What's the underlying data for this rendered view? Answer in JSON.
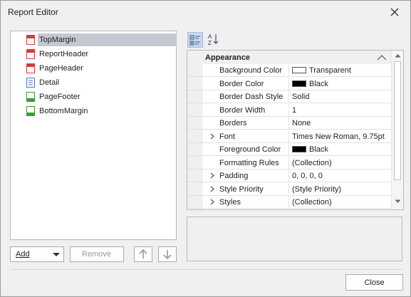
{
  "window": {
    "title": "Report Editor"
  },
  "tree": {
    "items": [
      {
        "label": "TopMargin",
        "icon": "band-icon",
        "color": "#d83b3b",
        "selected": true
      },
      {
        "label": "ReportHeader",
        "icon": "band-icon",
        "color": "#d83b3b"
      },
      {
        "label": "PageHeader",
        "icon": "band-icon",
        "color": "#d83b3b"
      },
      {
        "label": "Detail",
        "icon": "detail-band-icon",
        "color": "#4a78c2"
      },
      {
        "label": "PageFooter",
        "icon": "band-icon",
        "color": "#3c9a3c"
      },
      {
        "label": "BottomMargin",
        "icon": "band-icon",
        "color": "#3c9a3c"
      }
    ]
  },
  "buttons": {
    "add": "Add",
    "remove": "Remove",
    "close": "Close"
  },
  "property_grid": {
    "category": "Appearance",
    "rows": [
      {
        "name": "Background Color",
        "value": "Transparent",
        "swatch": "white"
      },
      {
        "name": "Border Color",
        "value": "Black",
        "swatch": "black"
      },
      {
        "name": "Border Dash Style",
        "value": "Solid"
      },
      {
        "name": "Border Width",
        "value": "1"
      },
      {
        "name": "Borders",
        "value": "None"
      },
      {
        "name": "Font",
        "value": "Times New Roman, 9.75pt",
        "expandable": true
      },
      {
        "name": "Foreground Color",
        "value": "Black",
        "swatch": "black"
      },
      {
        "name": "Formatting Rules",
        "value": "(Collection)"
      },
      {
        "name": "Padding",
        "value": "0, 0, 0, 0",
        "expandable": true
      },
      {
        "name": "Style Priority",
        "value": "(Style Priority)",
        "expandable": true
      },
      {
        "name": "Styles",
        "value": "(Collection)",
        "expandable": true
      }
    ]
  }
}
